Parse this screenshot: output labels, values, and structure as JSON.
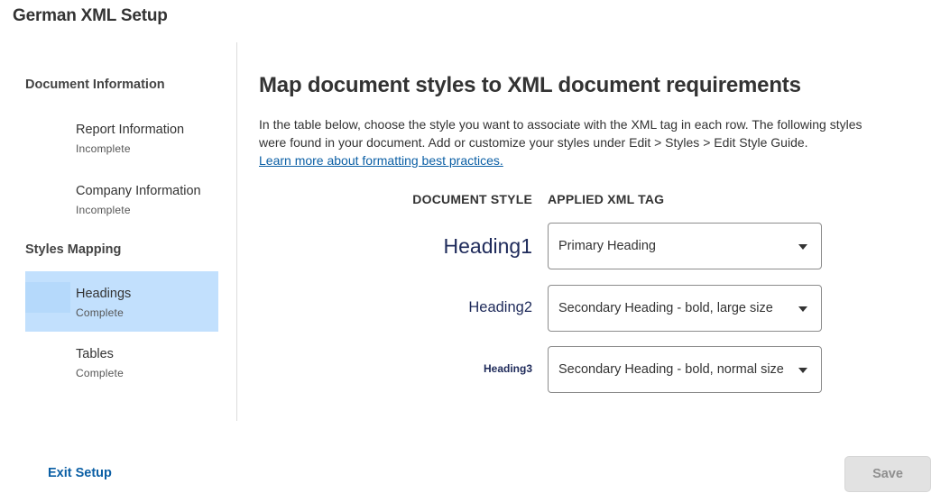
{
  "app": {
    "title": "German XML Setup"
  },
  "sidebar": {
    "sections": [
      {
        "title": "Document Information"
      },
      {
        "title": "Styles Mapping"
      }
    ],
    "items": [
      {
        "label": "Report Information",
        "status": "Incomplete",
        "active": false
      },
      {
        "label": "Company Information",
        "status": "Incomplete",
        "active": false
      },
      {
        "label": "Headings",
        "status": "Complete",
        "active": true
      },
      {
        "label": "Tables",
        "status": "Complete",
        "active": false
      }
    ]
  },
  "main": {
    "title": "Map document styles to XML document requirements",
    "intro_line1": "In the table below, choose the style you want to associate with the XML tag in each row. The following styles",
    "intro_line2": "were found in your document. Add or customize your styles under Edit > Styles > Edit Style Guide.",
    "learn_link": "Learn more about formatting best practices.",
    "columns": {
      "document_style": "DOCUMENT STYLE",
      "applied_xml_tag": "APPLIED XML TAG"
    },
    "rows": [
      {
        "document_style": "Heading1",
        "xml_tag": "Primary Heading"
      },
      {
        "document_style": "Heading2",
        "xml_tag": "Secondary Heading - bold, large size"
      },
      {
        "document_style": "Heading3",
        "xml_tag": "Secondary Heading - bold, normal size"
      }
    ]
  },
  "footer": {
    "exit_label": "Exit Setup",
    "save_label": "Save",
    "save_disabled": true
  },
  "colors": {
    "accent_link": "#0b5fa5",
    "active_item_bg": "#c2e0fd",
    "style_text": "#1e2a5a"
  }
}
